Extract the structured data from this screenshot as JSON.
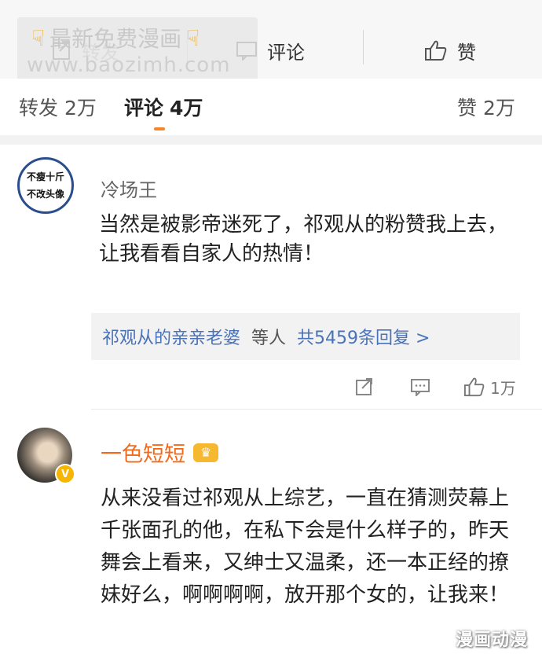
{
  "topbar": {
    "repost_label": "转发",
    "comment_label": "评论",
    "like_label": "赞",
    "icons": {
      "repost": "share-icon",
      "comment": "comment-icon",
      "like": "thumbs-up-icon"
    }
  },
  "watermark": {
    "line1": "最新免费漫画",
    "line2": "www.baozimh.com",
    "hand_icon": "pointing-hand-icon"
  },
  "tabs": [
    {
      "label": "转发",
      "count": "2万"
    },
    {
      "label": "评论",
      "count": "4万",
      "active": true
    },
    {
      "label": "赞",
      "count": "2万"
    }
  ],
  "accent_color": "#f7852a",
  "comments": [
    {
      "avatar_text": [
        "不瘦十斤",
        "不改头像"
      ],
      "username": "冷场王",
      "text": "当然是被影帝迷死了，祁观从的粉赞我上去，让我看看自家人的热情！",
      "reply_summary": {
        "user": "祁观从的亲亲老婆",
        "etc": "等人",
        "count": "共5459条回复 >"
      },
      "likes": "1万"
    },
    {
      "username": "一色短短",
      "badge": "V",
      "text": "从来没看过祁观从上综艺，一直在猜测荧幕上千张面孔的他，在私下会是什么样子的，昨天舞会上看来，又绅士又温柔，还一本正经的撩妹好么，啊啊啊啊，放开那个女的，让我来！"
    }
  ],
  "corner_watermark": "漫画动漫"
}
